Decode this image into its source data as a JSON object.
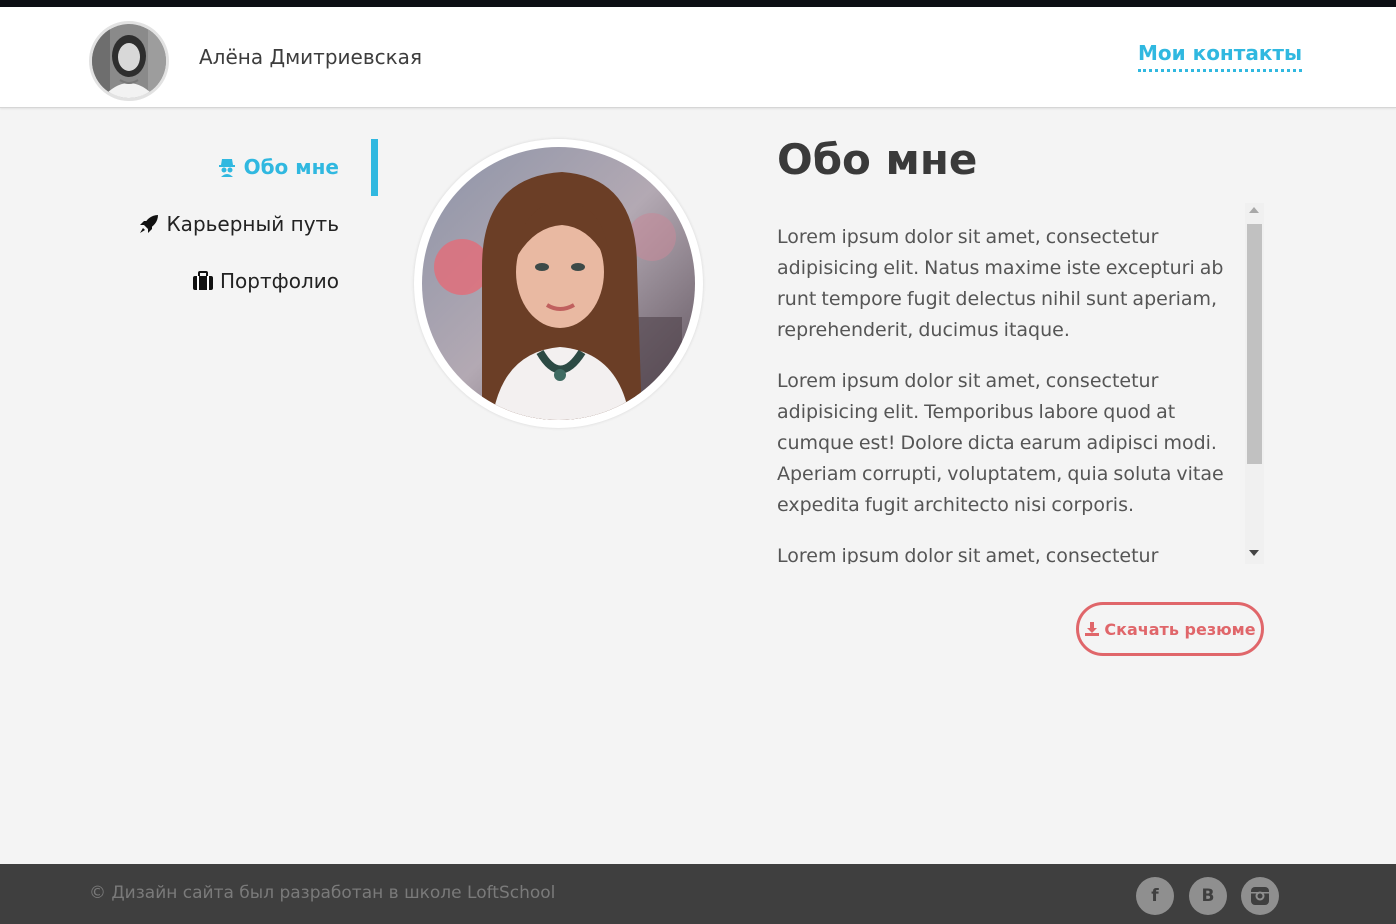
{
  "header": {
    "user_name": "Алёна Дмитриевская",
    "contacts_link": "Мои контакты",
    "accent_color": "#30b8e0"
  },
  "nav": {
    "items": [
      {
        "label": "Обо мне",
        "icon": "spy-icon",
        "active": true
      },
      {
        "label": "Карьерный путь",
        "icon": "rocket-icon",
        "active": false
      },
      {
        "label": "Портфолио",
        "icon": "briefcase-icon",
        "active": false
      }
    ]
  },
  "main": {
    "title": "Обо мне",
    "paragraphs": [
      "Lorem ipsum dolor sit amet, consectetur adipisicing elit. Natus maxime iste excepturi ab runt tempore fugit delectus nihil sunt aperiam, reprehenderit, ducimus itaque.",
      "Lorem ipsum dolor sit amet, consectetur adipisicing elit. Temporibus labore quod at cumque est! Dolore dicta earum adipisci modi. Aperiam corrupti, voluptatem, quia soluta vitae expedita fugit architecto nisi corporis.",
      "Lorem ipsum dolor sit amet, consectetur adipisicing"
    ],
    "download_label": "Скачать резюме",
    "download_color": "#e0666a"
  },
  "footer": {
    "copyright": "© Дизайн сайта был разработан в школе LoftSchool",
    "social": [
      {
        "icon": "facebook-icon",
        "glyph": "f"
      },
      {
        "icon": "vk-icon",
        "glyph": "B"
      },
      {
        "icon": "instagram-icon",
        "glyph": ""
      }
    ]
  }
}
